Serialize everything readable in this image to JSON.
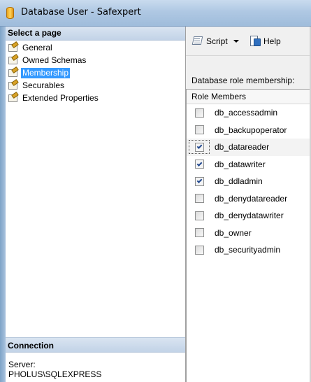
{
  "window": {
    "title": "Database User - Safexpert"
  },
  "left_pane": {
    "header": "Select a page",
    "pages": [
      {
        "label": "General",
        "selected": false
      },
      {
        "label": "Owned Schemas",
        "selected": false
      },
      {
        "label": "Membership",
        "selected": true
      },
      {
        "label": "Securables",
        "selected": false
      },
      {
        "label": "Extended Properties",
        "selected": false
      }
    ],
    "connection": {
      "header": "Connection",
      "server_label": "Server:",
      "server_value": "PHOLUS\\SQLEXPRESS"
    }
  },
  "toolbar": {
    "script_label": "Script",
    "help_label": "Help"
  },
  "membership": {
    "section_label": "Database role membership:",
    "column_header": "Role Members",
    "roles": [
      {
        "name": "db_accessadmin",
        "checked": false
      },
      {
        "name": "db_backupoperator",
        "checked": false
      },
      {
        "name": "db_datareader",
        "checked": true,
        "focused": true
      },
      {
        "name": "db_datawriter",
        "checked": true
      },
      {
        "name": "db_ddladmin",
        "checked": true
      },
      {
        "name": "db_denydatareader",
        "checked": false
      },
      {
        "name": "db_denydatawriter",
        "checked": false
      },
      {
        "name": "db_owner",
        "checked": false
      },
      {
        "name": "db_securityadmin",
        "checked": false
      }
    ]
  }
}
